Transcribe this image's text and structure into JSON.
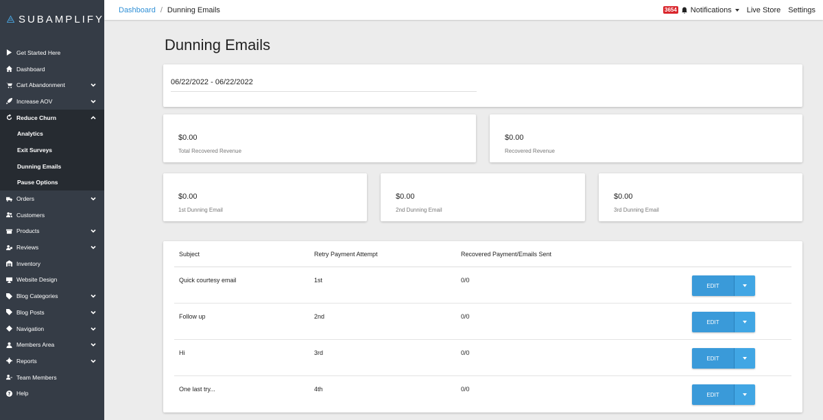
{
  "brand": {
    "name": "SUBAMPLIFY"
  },
  "sidebar": {
    "items": [
      {
        "label": "Get Started Here",
        "icon": "play-icon",
        "chevron": false
      },
      {
        "label": "Dashboard",
        "icon": "home-icon",
        "chevron": false
      },
      {
        "label": "Cart Abandonment",
        "icon": "cart-icon",
        "chevron": true
      },
      {
        "label": "Increase AOV",
        "icon": "rocket-icon",
        "chevron": true
      },
      {
        "label": "Reduce Churn",
        "icon": "refresh-icon",
        "chevron": true,
        "expanded": true
      },
      {
        "label": "Orders",
        "icon": "truck-icon",
        "chevron": true
      },
      {
        "label": "Customers",
        "icon": "users-icon",
        "chevron": false
      },
      {
        "label": "Products",
        "icon": "box-icon",
        "chevron": true
      },
      {
        "label": "Reviews",
        "icon": "user-comment-icon",
        "chevron": true
      },
      {
        "label": "Inventory",
        "icon": "warehouse-icon",
        "chevron": false
      },
      {
        "label": "Website Design",
        "icon": "desktop-icon",
        "chevron": false
      },
      {
        "label": "Blog Categories",
        "icon": "tag-icon",
        "chevron": true
      },
      {
        "label": "Blog Posts",
        "icon": "tag-icon",
        "chevron": true
      },
      {
        "label": "Navigation",
        "icon": "compass-icon",
        "chevron": true
      },
      {
        "label": "Members Area",
        "icon": "user-icon",
        "chevron": true
      },
      {
        "label": "Reports",
        "icon": "gear-icon",
        "chevron": true
      },
      {
        "label": "Team Members",
        "icon": "team-icon",
        "chevron": false
      },
      {
        "label": "Help",
        "icon": "question-icon",
        "chevron": false
      }
    ],
    "reduce_churn_sub": [
      "Analytics",
      "Exit Surveys",
      "Dunning Emails",
      "Pause Options"
    ]
  },
  "topbar": {
    "breadcrumb_home": "Dashboard",
    "breadcrumb_sep": "/",
    "breadcrumb_current": "Dunning Emails",
    "badge_count": "3654",
    "notifications": "Notifications",
    "live_store": "Live Store",
    "settings": "Settings"
  },
  "page": {
    "title": "Dunning Emails",
    "date_range": "06/22/2022 - 06/22/2022"
  },
  "stats": {
    "total_recovered": {
      "value": "$0.00",
      "label": "Total Recovered Revenue"
    },
    "recovered": {
      "value": "$0.00",
      "label": "Recovered Revenue"
    },
    "first": {
      "value": "$0.00",
      "label": "1st Dunning Email"
    },
    "second": {
      "value": "$0.00",
      "label": "2nd Dunning Email"
    },
    "third": {
      "value": "$0.00",
      "label": "3rd Dunning Email"
    }
  },
  "table": {
    "headers": [
      "Subject",
      "Retry Payment Attempt",
      "Recovered Payment/Emails Sent"
    ],
    "rows": [
      {
        "subject": "Quick courtesy email",
        "attempt": "1st",
        "ratio": "0/0",
        "button": "EDIT"
      },
      {
        "subject": "Follow up",
        "attempt": "2nd",
        "ratio": "0/0",
        "button": "EDIT"
      },
      {
        "subject": "Hi",
        "attempt": "3rd",
        "ratio": "0/0",
        "button": "EDIT"
      },
      {
        "subject": "One last try...",
        "attempt": "4th",
        "ratio": "0/0",
        "button": "EDIT"
      }
    ]
  },
  "colors": {
    "sidebar_bg": "#353c46",
    "sidebar_active": "#262b31",
    "accent": "#2e8fd6",
    "button": "#3a9ad9",
    "badge": "#d9262c"
  }
}
